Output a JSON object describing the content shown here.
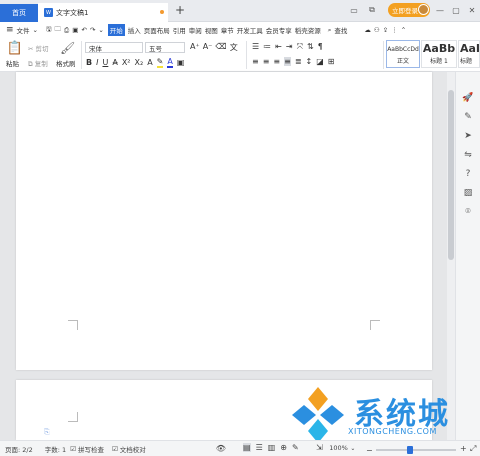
{
  "titlebar": {
    "home_tab": "首页",
    "doc_tab": "文字文稿1",
    "doc_icon": "W",
    "login": "立即登录"
  },
  "menubar": {
    "file": "文件",
    "tabs": [
      "开始",
      "插入",
      "页面布局",
      "引用",
      "审阅",
      "视图",
      "章节",
      "开发工具",
      "会员专享",
      "稻壳资源"
    ],
    "search": "查找"
  },
  "ribbon": {
    "paste": "粘贴",
    "cut": "剪切",
    "copy": "复制",
    "format_painter": "格式刷",
    "font_name": "宋体",
    "font_size": "五号",
    "styles": [
      {
        "preview": "AaBbCcDd",
        "name": "正文"
      },
      {
        "preview": "AaBb",
        "name": "标题 1"
      },
      {
        "preview": "AaI",
        "name": "标题"
      }
    ]
  },
  "status": {
    "page": "页面: 2/2",
    "words": "字数: 1",
    "spell": "拼写检查",
    "proof": "文档校对",
    "zoom": "100%"
  },
  "watermark": {
    "title": "系统城",
    "url": "XITONGCHENG.COM"
  },
  "colors": {
    "accent": "#2b6fd8",
    "login": "#f3a021",
    "highlight": "#f5e03a",
    "font_color": "#2b3bd8"
  }
}
